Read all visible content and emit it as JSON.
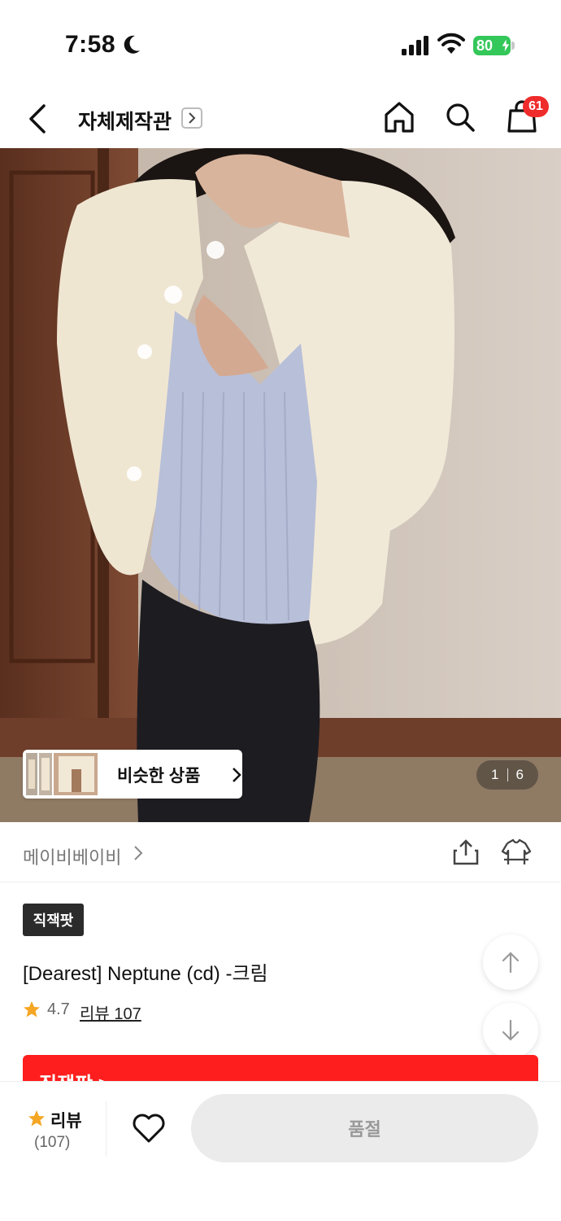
{
  "status_bar": {
    "time": "7:58",
    "battery": "80"
  },
  "header": {
    "title": "자체제작관",
    "cart_count": "61"
  },
  "gallery": {
    "similar_label": "비슷한 상품",
    "current_page": "1",
    "total_pages": "6"
  },
  "brand": {
    "name": "메이비베이비"
  },
  "product": {
    "badge": "직잭팟",
    "title": "[Dearest] Neptune (cd) -크림",
    "rating": "4.7",
    "review_link": "리뷰 107"
  },
  "promo": {
    "text": "직잭팟 >"
  },
  "bottom_bar": {
    "review_label": "리뷰",
    "review_count": "(107)",
    "soldout_label": "품절"
  },
  "colors": {
    "accent_red": "#ef2b2b",
    "promo_red": "#ff1e1e",
    "star": "#f5a623",
    "battery_green": "#34c759"
  }
}
